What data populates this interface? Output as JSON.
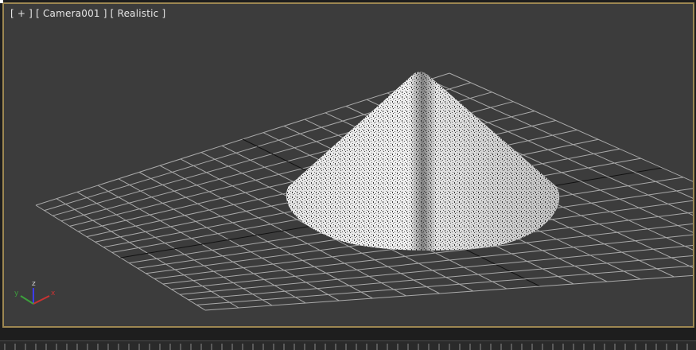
{
  "viewport": {
    "label_plus": "[ + ]",
    "label_camera": "[ Camera001 ]",
    "label_shading": "[ Realistic ]",
    "border_color": "#9d8752",
    "background_color": "#3c3c3c",
    "grid_color": "#a9a9a9",
    "object": "cone-mesh",
    "axis_gizmo": {
      "x_label": "x",
      "y_label": "y",
      "z_label": "z",
      "x_color": "#c83232",
      "y_color": "#3ca03c",
      "z_color": "#3c3cff"
    }
  }
}
